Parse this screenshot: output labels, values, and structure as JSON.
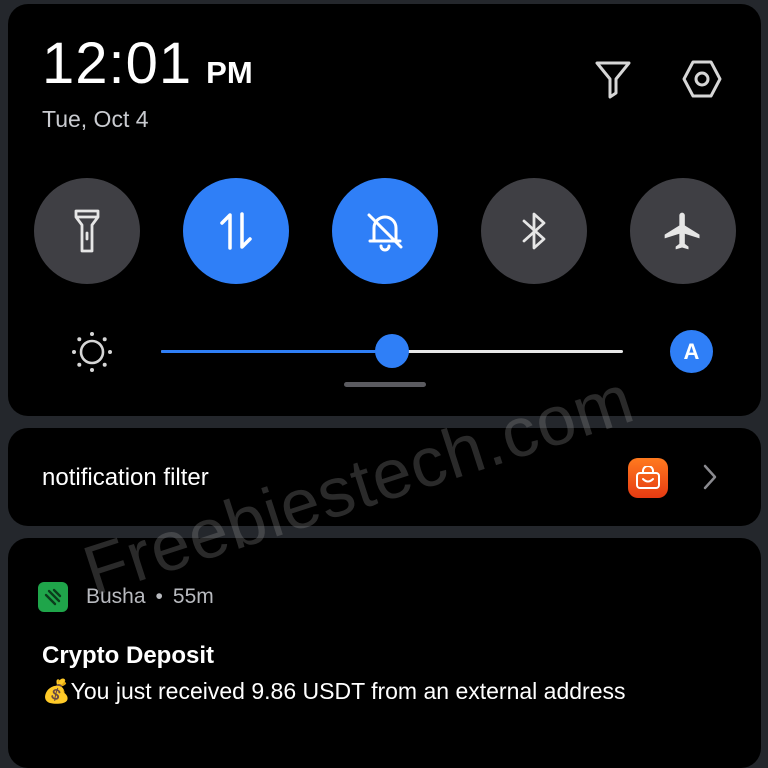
{
  "status": {
    "time": "12:01",
    "ampm": "PM",
    "date": "Tue, Oct 4"
  },
  "header_icons": [
    "filter-icon",
    "settings-icon"
  ],
  "quick_tiles": [
    {
      "id": "flashlight",
      "icon": "flashlight-icon",
      "active": false
    },
    {
      "id": "mobile-data",
      "icon": "data-arrows-icon",
      "active": true
    },
    {
      "id": "do-not-disturb",
      "icon": "bell-off-icon",
      "active": true
    },
    {
      "id": "bluetooth",
      "icon": "bluetooth-icon",
      "active": false
    },
    {
      "id": "airplane-mode",
      "icon": "airplane-icon",
      "active": false
    }
  ],
  "brightness": {
    "level": 0.5,
    "icon": "sun-icon",
    "auto_label": "A"
  },
  "notification_filter": {
    "label": "notification filter",
    "app_icon": "shopping-app-icon"
  },
  "notification": {
    "app_name": "Busha",
    "separator": "•",
    "time": "55m",
    "title": "Crypto Deposit",
    "body": "💰You just received 9.86 USDT from an external address"
  },
  "watermark": "Freebiestech.com",
  "colors": {
    "accent": "#2f7ff7",
    "tile_off": "#3f3f44",
    "panel": "#000000",
    "app_green": "#1fa54a"
  }
}
